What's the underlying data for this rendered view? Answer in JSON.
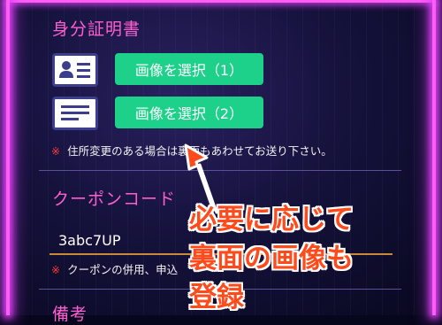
{
  "id_section": {
    "title": "身分証明書",
    "buttons": [
      {
        "label": "画像を選択（1）"
      },
      {
        "label": "画像を選択（2）"
      }
    ],
    "note_mark": "※",
    "note": "住所変更のある場合は裏面もあわせてお送り下さい。"
  },
  "coupon_section": {
    "title": "クーポンコード",
    "value": "3abc7UP",
    "note_mark": "※",
    "note": "クーポンの併用、申込"
  },
  "remarks_section": {
    "title": "備考"
  },
  "annotation": {
    "lines": [
      "必要に応じて",
      "裏面の画像も",
      "登録"
    ],
    "color": "#ff4a1c"
  },
  "colors": {
    "accent_pink": "#ff5ed0",
    "button_green": "#1ed18a",
    "neon": "#ff5cf4"
  }
}
